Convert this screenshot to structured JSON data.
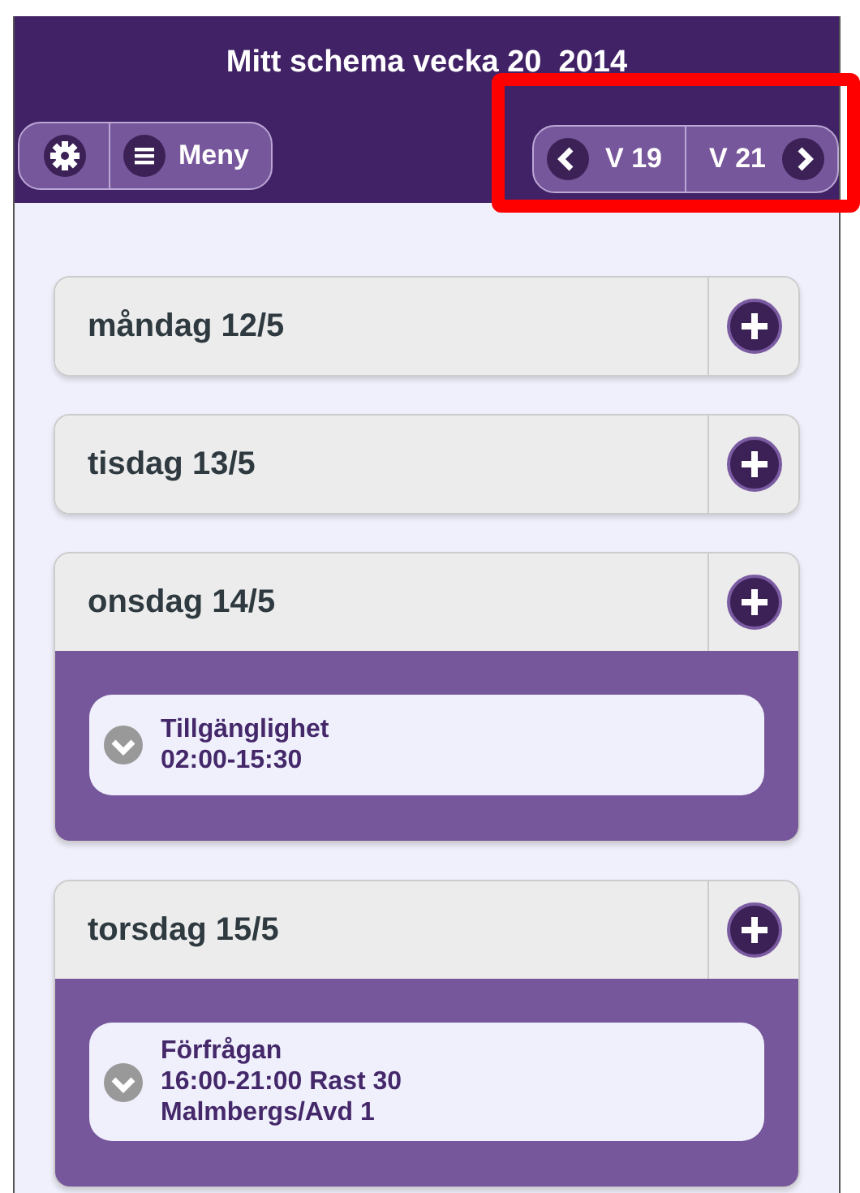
{
  "header": {
    "title": "Mitt schema vecka 20  2014",
    "menu_label": "Meny",
    "prev_week": "V 19",
    "next_week": "V 21"
  },
  "days": [
    {
      "label": "måndag 12/5"
    },
    {
      "label": "tisdag 13/5"
    },
    {
      "label": "onsdag 14/5",
      "events": [
        {
          "lines": [
            "Tillgänglighet",
            "02:00-15:30"
          ]
        }
      ]
    },
    {
      "label": "torsdag 15/5",
      "events": [
        {
          "lines": [
            "Förfrågan",
            "16:00-21:00 Rast 30",
            "Malmbergs/Avd 1"
          ]
        }
      ]
    }
  ]
}
